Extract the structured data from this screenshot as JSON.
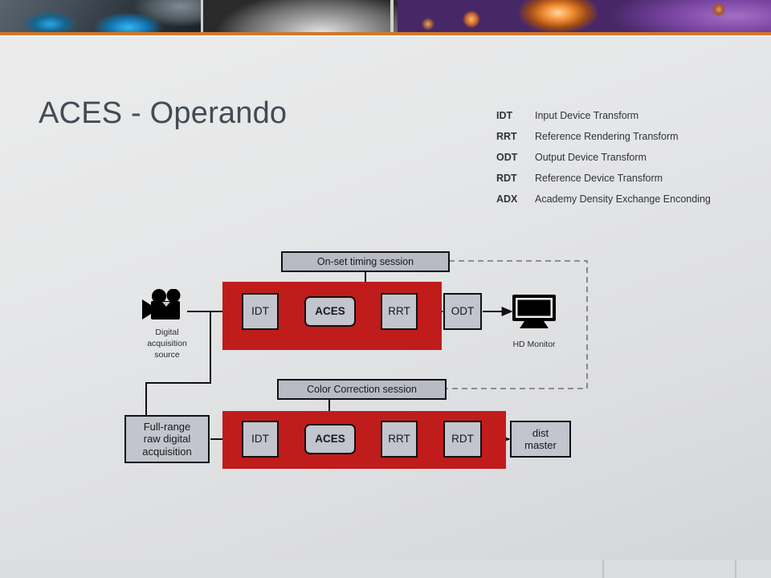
{
  "header": {
    "banner_panes": [
      "blue-glass-image",
      "metal-disc-image",
      "nebula-image"
    ],
    "accent_color": "#d2762b"
  },
  "slide": {
    "title": "ACES - Operando"
  },
  "glossary": {
    "rows": [
      {
        "abbr": "IDT",
        "desc": "Input Device Transform"
      },
      {
        "abbr": "RRT",
        "desc": "Reference Rendering Transform"
      },
      {
        "abbr": "ODT",
        "desc": "Output Device Transform"
      },
      {
        "abbr": "RDT",
        "desc": "Reference Device Transform"
      },
      {
        "abbr": "ADX",
        "desc": "Academy Density Exchange Enconding"
      }
    ]
  },
  "diagram": {
    "colors": {
      "band": "#c01c1c",
      "box": "#c2c5cd",
      "session": "#b8bbc6",
      "stroke": "#111111"
    },
    "source": {
      "icon": "movie-camera-icon",
      "caption_line1": "Digital",
      "caption_line2": "acquisition",
      "caption_line3": "source"
    },
    "top_session": "On-set timing session",
    "bottom_session": "Color Correction session",
    "top_chain": [
      "IDT",
      "ACES",
      "RRT",
      "ODT"
    ],
    "bottom_chain": [
      "IDT",
      "ACES",
      "RRT",
      "RDT"
    ],
    "output_top": {
      "icon": "hd-monitor-icon",
      "label": "HD Monitor"
    },
    "input_bottom_line1": "Full-range",
    "input_bottom_line2": "raw digital",
    "input_bottom_line3": "acquisition",
    "output_bottom_line1": "dist",
    "output_bottom_line2": "master"
  },
  "footer": {
    "divider_positions": "750, 915"
  }
}
